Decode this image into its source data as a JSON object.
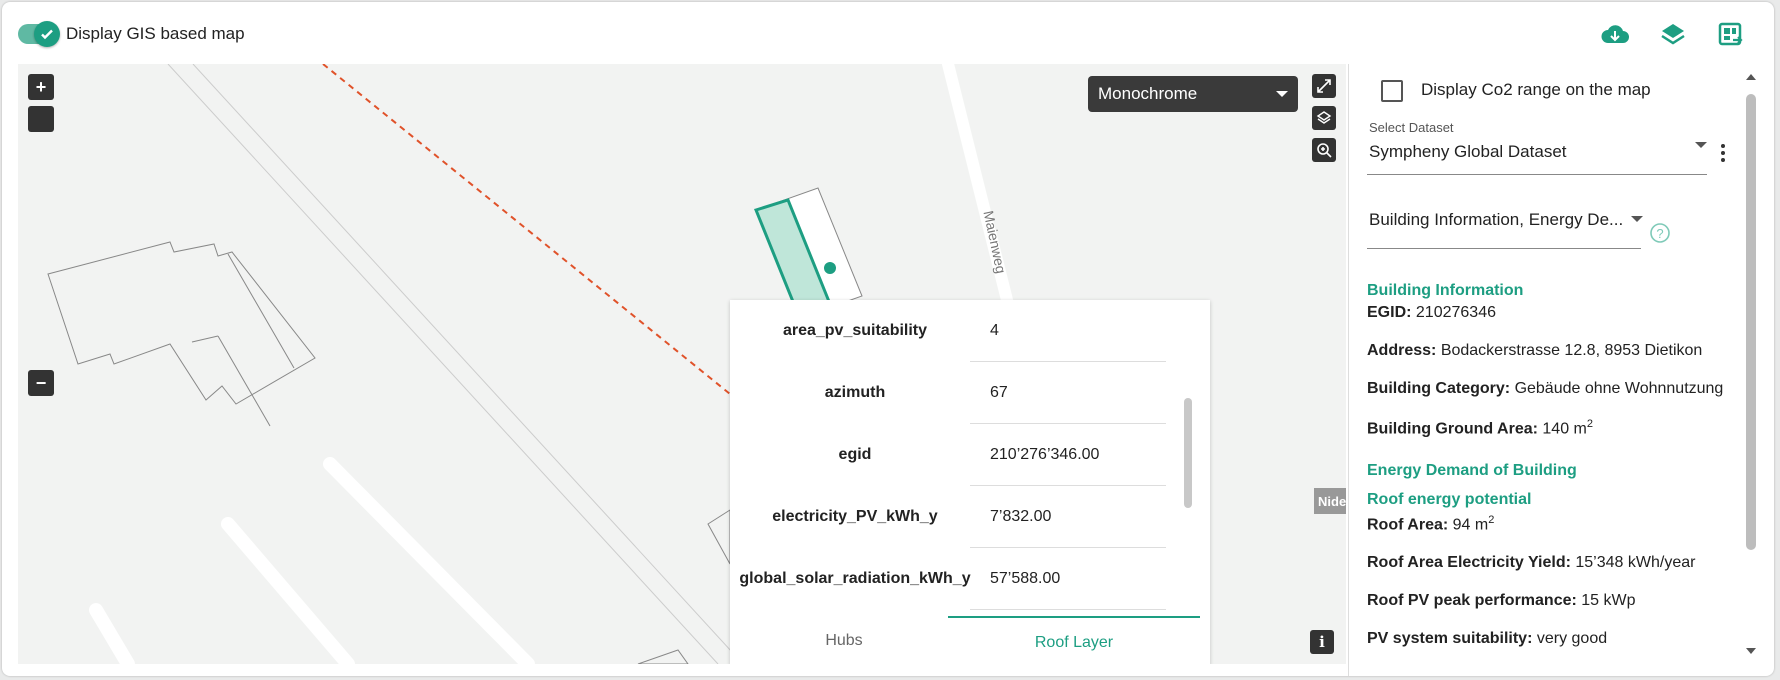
{
  "topbar": {
    "toggle_label": "Display GIS based map",
    "icons": [
      "cloud-download-icon",
      "layers-icon",
      "map-link-icon"
    ]
  },
  "map": {
    "zoom_in": "+",
    "zoom_out": "−",
    "basemap_select": "Monochrome",
    "street_label": "Maienweg",
    "edge_label": "Nide",
    "info_button": "i"
  },
  "popup": {
    "rows": [
      {
        "key": "area_pv_suitability",
        "value": "4"
      },
      {
        "key": "azimuth",
        "value": "67"
      },
      {
        "key": "egid",
        "value": "210’276’346.00"
      },
      {
        "key": "electricity_PV_kWh_y",
        "value": "7’832.00"
      },
      {
        "key": "global_solar_radiation_kWh_y",
        "value": "57’588.00"
      }
    ],
    "tabs": [
      "Hubs",
      "Roof Layer"
    ],
    "active_tab": "Roof Layer"
  },
  "panel": {
    "co2_checkbox_label": "Display Co2 range on the map",
    "dataset_label": "Select Dataset",
    "dataset_value": "Sympheny Global Dataset",
    "layers_value": "Building Information, Energy De...",
    "building_info_title": "Building Information",
    "egid_label": "EGID:",
    "egid_value": "210276346",
    "address_label": "Address:",
    "address_value": "Bodackerstrasse 12.8, 8953 Dietikon",
    "category_label": "Building Category:",
    "category_value": "Gebäude ohne Wohnnutzung",
    "ground_area_label": "Building Ground Area:",
    "ground_area_value": "140 m",
    "energy_demand_title": "Energy Demand of Building",
    "roof_potential_title": "Roof energy potential",
    "roof_area_label": "Roof Area:",
    "roof_area_value": "94 m",
    "roof_yield_label": "Roof Area Electricity Yield:",
    "roof_yield_value": "15’348 kWh/year",
    "pv_peak_label": "Roof PV peak performance:",
    "pv_peak_value": "15 kWp",
    "pv_suit_label": "PV system suitability:",
    "pv_suit_value": "very good",
    "sup": "2"
  },
  "colors": {
    "accent": "#1d9e82",
    "map_bg": "#f2f3f2",
    "dashed_line": "#e0522a",
    "dark_control": "#333333"
  }
}
